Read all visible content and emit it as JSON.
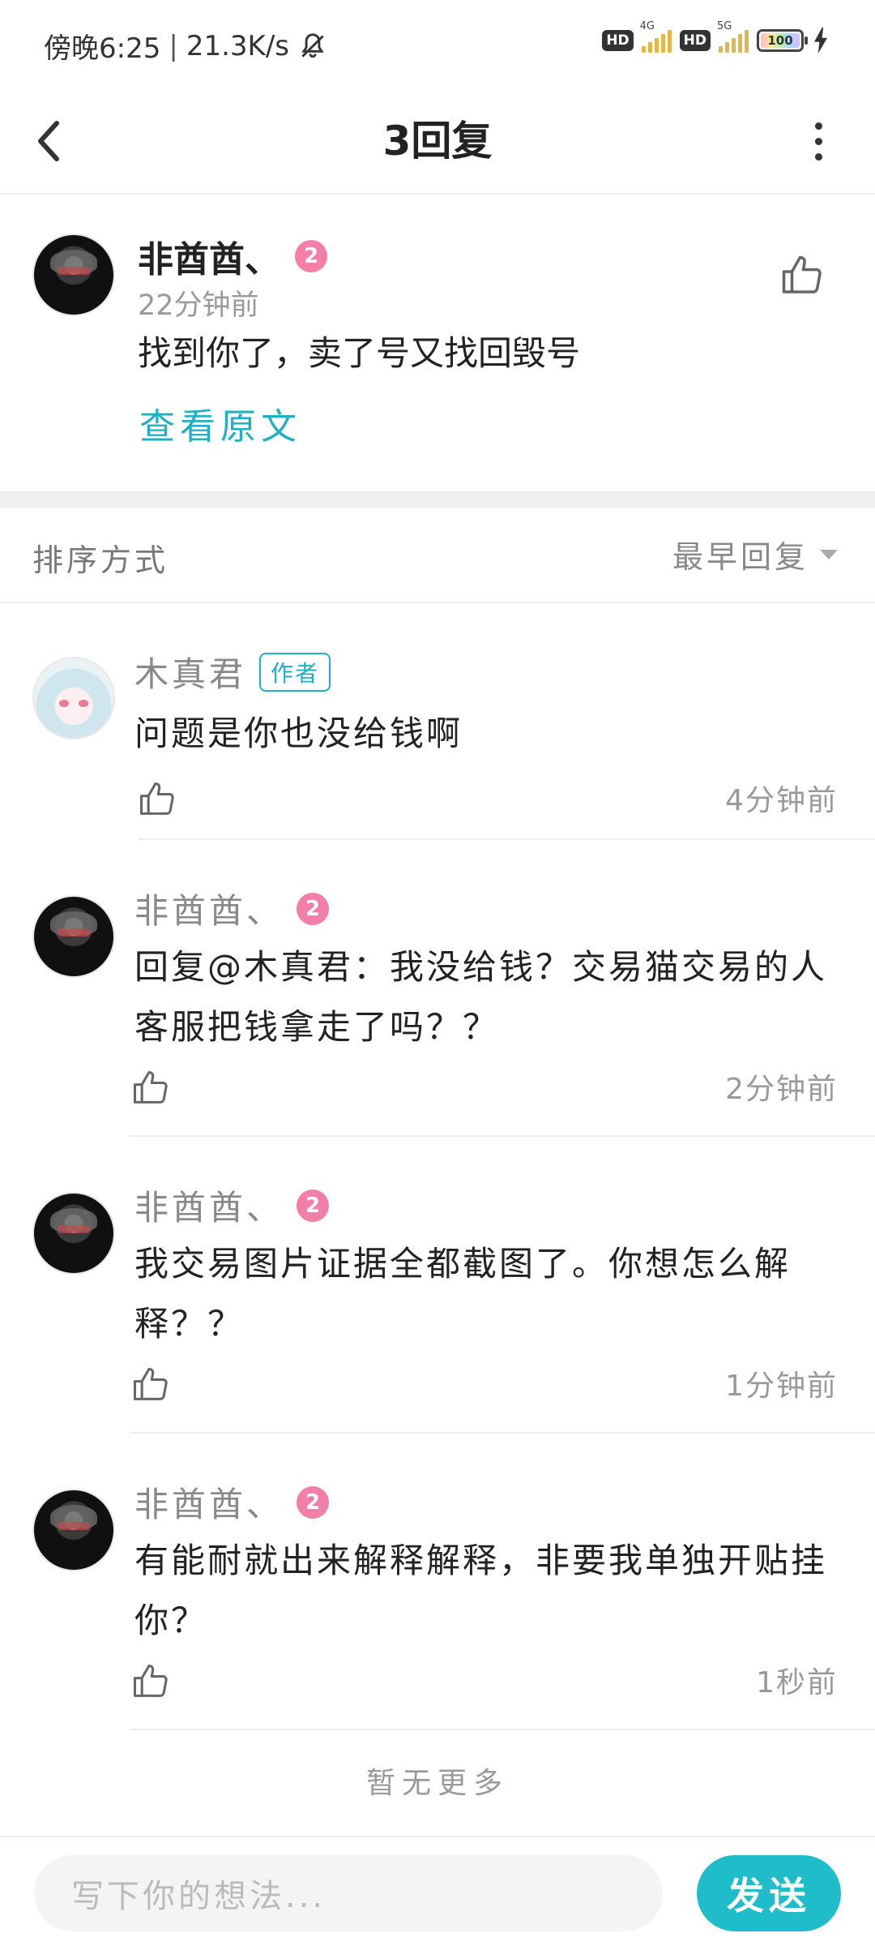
{
  "status_bar": {
    "time": "傍晚6:25",
    "speed": "21.3K/s",
    "hd1": "HD",
    "net1": "4G",
    "hd2": "HD",
    "net2": "5G",
    "battery": "100"
  },
  "header": {
    "title": "3回复"
  },
  "main_post": {
    "author": "非酋酋、",
    "level": "2",
    "time": "22分钟前",
    "text": "找到你了，卖了号又找回毁号",
    "view_original": "查看原文"
  },
  "sort": {
    "label": "排序方式",
    "selected": "最早回复"
  },
  "replies": [
    {
      "author": "木真君",
      "tag": "作者",
      "text": "问题是你也没给钱啊",
      "time": "4分钟前"
    },
    {
      "author": "非酋酋、",
      "level": "2",
      "text": "回复@木真君：我没给钱？交易猫交易的人客服把钱拿走了吗？？",
      "time": "2分钟前"
    },
    {
      "author": "非酋酋、",
      "level": "2",
      "text": "我交易图片证据全都截图了。你想怎么解释？？",
      "time": "1分钟前"
    },
    {
      "author": "非酋酋、",
      "level": "2",
      "text": "有能耐就出来解释解释，非要我单独开贴挂你？",
      "time": "1秒前"
    }
  ],
  "footer": {
    "no_more": "暂无更多",
    "input_placeholder": "写下你的想法...",
    "send_label": "发送"
  },
  "colors": {
    "accent": "#1fbcc9",
    "level_badge": "#f37fa8"
  }
}
